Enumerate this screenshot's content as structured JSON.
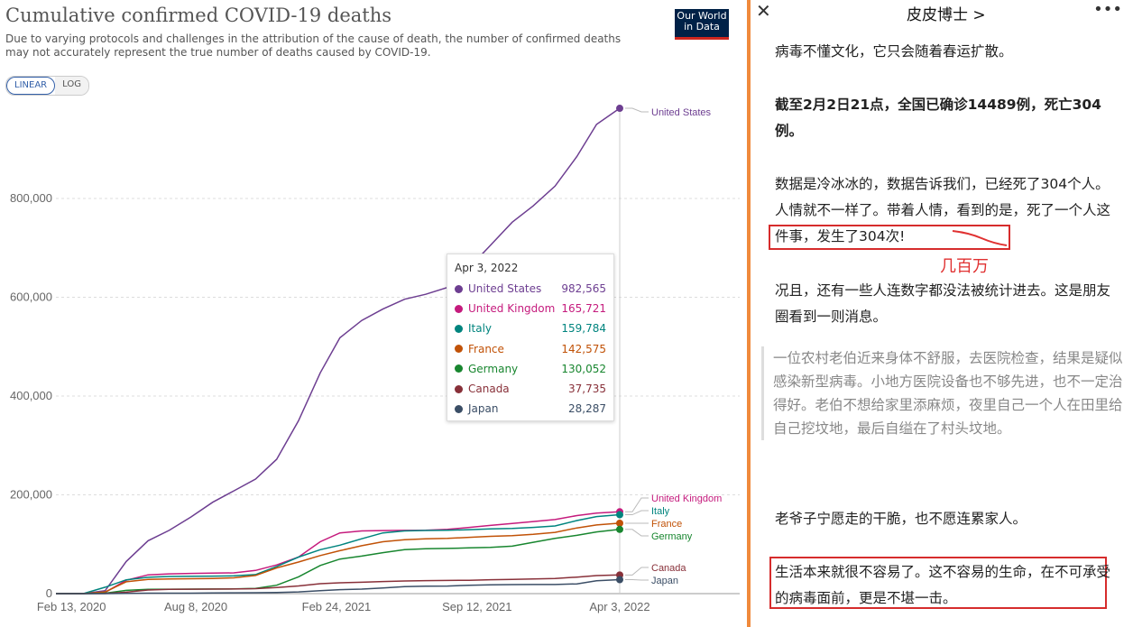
{
  "chart_header": {
    "title": "Cumulative confirmed COVID-19 deaths",
    "subtitle": "Due to varying protocols and challenges in the attribution of the cause of death, the number of confirmed deaths may not accurately represent the true number of deaths caused by COVID-19.",
    "logo_line1": "Our World",
    "logo_line2": "in Data",
    "scale_linear": "LINEAR",
    "scale_log": "LOG"
  },
  "chart_data": {
    "type": "line",
    "title": "Cumulative confirmed COVID-19 deaths",
    "x_ticks": [
      "Feb 13, 2020",
      "Aug 8, 2020",
      "Feb 24, 2021",
      "Sep 12, 2021",
      "Apr 3, 2022"
    ],
    "y_ticks": [
      "0",
      "200,000",
      "400,000",
      "600,000",
      "800,000"
    ],
    "ylim": [
      0,
      1000000
    ],
    "x": [
      "2020-01-22",
      "2020-03-01",
      "2020-04-01",
      "2020-05-01",
      "2020-06-01",
      "2020-07-01",
      "2020-08-01",
      "2020-09-01",
      "2020-10-01",
      "2020-11-01",
      "2020-12-01",
      "2021-01-01",
      "2021-02-01",
      "2021-03-01",
      "2021-04-01",
      "2021-05-01",
      "2021-06-01",
      "2021-07-01",
      "2021-08-01",
      "2021-09-01",
      "2021-10-01",
      "2021-11-01",
      "2021-12-01",
      "2022-01-01",
      "2022-02-01",
      "2022-03-01",
      "2022-04-03"
    ],
    "series": [
      {
        "name": "United States",
        "color": "#6d3e91",
        "values": [
          0,
          1,
          6000,
          65000,
          107000,
          128000,
          155000,
          185000,
          208000,
          232000,
          272000,
          350000,
          447000,
          518000,
          553000,
          576000,
          596000,
          606000,
          620000,
          660000,
          705000,
          752000,
          785000,
          825000,
          885000,
          950000,
          982565
        ]
      },
      {
        "name": "United Kingdom",
        "color": "#c51b7d",
        "values": [
          0,
          0,
          2500,
          27000,
          38000,
          40000,
          41000,
          41500,
          42000,
          47000,
          58000,
          74000,
          105000,
          123000,
          127000,
          127600,
          128000,
          128400,
          130000,
          134000,
          138000,
          142000,
          146000,
          150000,
          158000,
          163000,
          165721
        ]
      },
      {
        "name": "Italy",
        "color": "#00847e",
        "values": [
          0,
          30,
          13000,
          28000,
          33000,
          34700,
          35100,
          35400,
          35900,
          38600,
          55000,
          74000,
          89000,
          98000,
          111000,
          123000,
          127000,
          127800,
          128200,
          129500,
          131000,
          132000,
          134000,
          137000,
          148000,
          156000,
          159784
        ]
      },
      {
        "name": "France",
        "color": "#c15207",
        "values": [
          0,
          0,
          3500,
          24000,
          28800,
          29800,
          30200,
          30600,
          31900,
          36700,
          52000,
          64000,
          77000,
          87000,
          97000,
          105000,
          109000,
          110800,
          111800,
          114000,
          116000,
          117500,
          120000,
          124000,
          133000,
          139000,
          142575
        ]
      },
      {
        "name": "Germany",
        "color": "#18862f",
        "values": [
          0,
          0,
          1000,
          6600,
          8500,
          9000,
          9100,
          9300,
          9500,
          10500,
          17000,
          34000,
          57000,
          70000,
          76000,
          83000,
          89000,
          90900,
          91500,
          92600,
          93700,
          96000,
          104000,
          112000,
          118000,
          125000,
          130052
        ]
      },
      {
        "name": "Canada",
        "color": "#883039",
        "values": [
          0,
          0,
          100,
          3000,
          7300,
          8600,
          8900,
          9100,
          9300,
          10000,
          12300,
          15600,
          20000,
          22000,
          23000,
          24500,
          25600,
          26300,
          26700,
          27100,
          28200,
          28900,
          29600,
          30500,
          33500,
          36500,
          37735
        ]
      },
      {
        "name": "Japan",
        "color": "#3b4e66",
        "values": [
          0,
          5,
          50,
          450,
          890,
          980,
          1000,
          1300,
          1600,
          1800,
          2300,
          3500,
          5800,
          8000,
          9200,
          11500,
          14200,
          15000,
          15400,
          16900,
          17900,
          18300,
          18400,
          18400,
          19800,
          26000,
          28287
        ]
      }
    ],
    "tooltip": {
      "date": "Apr 3, 2022",
      "rows": [
        {
          "name": "United States",
          "value": "982,565",
          "color": "#6d3e91"
        },
        {
          "name": "United Kingdom",
          "value": "165,721",
          "color": "#c51b7d"
        },
        {
          "name": "Italy",
          "value": "159,784",
          "color": "#00847e"
        },
        {
          "name": "France",
          "value": "142,575",
          "color": "#c15207"
        },
        {
          "name": "Germany",
          "value": "130,052",
          "color": "#18862f"
        },
        {
          "name": "Canada",
          "value": "37,735",
          "color": "#883039"
        },
        {
          "name": "Japan",
          "value": "28,287",
          "color": "#3b4e66"
        }
      ]
    }
  },
  "article": {
    "account_name": "皮皮博士 >",
    "close_glyph": "✕",
    "more_glyph": "•••",
    "p1": "病毒不懂文化，它只会随着春运扩散。",
    "p2": "截至2月2日21点，全国已确诊14489例，死亡304例。",
    "p3": "数据是冷冰冰的，数据告诉我们，已经死了304个人。人情就不一样了。带着人情，看到的是，死了一个人这件事，发生了304次!",
    "annotation": "几百万",
    "p4": "况且，还有一些人连数字都没法被统计进去。这是朋友圈看到一则消息。",
    "quote": "一位农村老伯近来身体不舒服，去医院检查，结果是疑似感染新型病毒。小地方医院设备也不够先进，也不一定治得好。老伯不想给家里添麻烦，夜里自己一个人在田里给自己挖坟地，最后自缢在了村头坟地。",
    "p5": "老爷子宁愿走的干脆，也不愿连累家人。",
    "p6": "生活本来就很不容易了。这不容易的生命，在不可承受的病毒面前，更是不堪一击。"
  }
}
